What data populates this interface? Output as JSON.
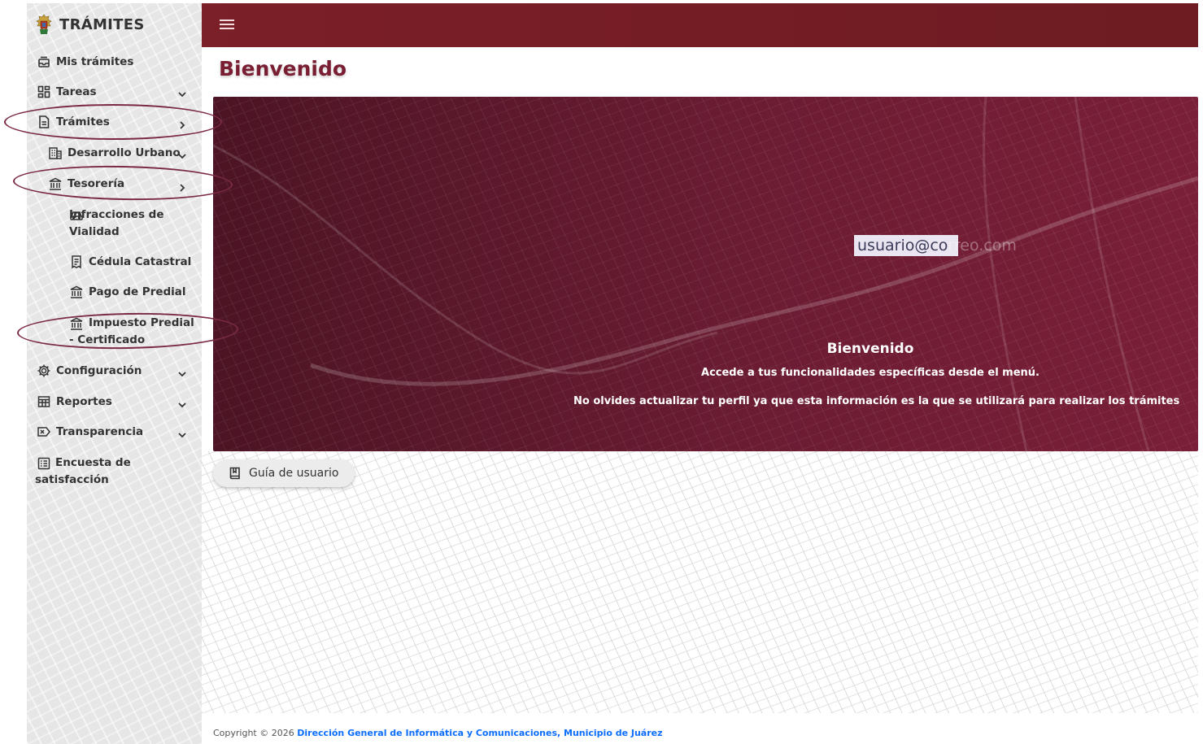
{
  "sidebar": {
    "brand_title": "TRÁMITES",
    "items": [
      {
        "label": "Mis trámites",
        "icon": "inbox-icon"
      },
      {
        "label": "Tareas",
        "icon": "dashboard-icon",
        "chevron": "down"
      },
      {
        "label": "Trámites",
        "icon": "document-icon",
        "chevron": "right"
      },
      {
        "label": "Desarrollo Urbano",
        "icon": "building-icon",
        "chevron": "down"
      },
      {
        "label": "Tesorería",
        "icon": "bank-icon",
        "chevron": "right"
      },
      {
        "label": "Infracciones de Vialidad",
        "icon": "car-icon"
      },
      {
        "label": "Cédula Catastral",
        "icon": "receipt-icon"
      },
      {
        "label": "Pago de Predial",
        "icon": "bank-icon"
      },
      {
        "label": "Impuesto Predial - Certificado",
        "icon": "bank-icon"
      },
      {
        "label": "Configuración",
        "icon": "gear-icon",
        "chevron": "down"
      },
      {
        "label": "Reportes",
        "icon": "table-icon",
        "chevron": "down"
      },
      {
        "label": "Transparencia",
        "icon": "transparency-icon",
        "chevron": "down"
      },
      {
        "label": "Encuesta de satisfacción",
        "icon": "survey-icon"
      }
    ]
  },
  "topbar": {
    "menu_icon": "hamburger-icon"
  },
  "main": {
    "title": "Bienvenido",
    "hero": {
      "email_visible": "usuario@co",
      "email_faded": "rreo.com",
      "heading": "Bienvenido",
      "line1": "Accede a tus funcionalidades específicas desde el menú.",
      "line2": "No olvides actualizar tu perfil ya que esta información es la que se utilizará para realizar los trámites"
    },
    "guide_button": {
      "label": "Guía de usuario",
      "icon": "book-icon"
    }
  },
  "footer": {
    "prefix": "Copyright © 2026",
    "link": "Dirección General de Informática y Comunicaciones, Municipio de Juárez"
  },
  "colors": {
    "primary": "#7b1f28",
    "hero": "#5c1a2c",
    "title": "#7a1f33",
    "link": "#0d6efd",
    "annotation": "#7b2a45"
  }
}
